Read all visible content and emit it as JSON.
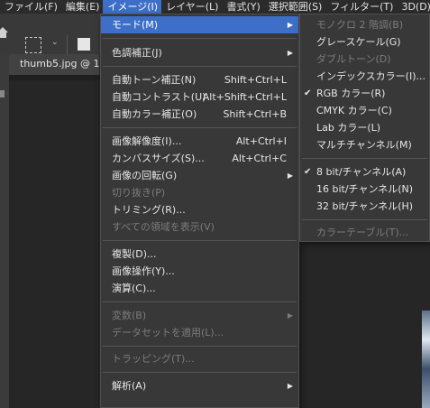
{
  "menubar": {
    "items": [
      "ファイル(F)",
      "編集(E)",
      "イメージ(I)",
      "レイヤー(L)",
      "書式(Y)",
      "選択範囲(S)",
      "フィルター(T)",
      "3D(D)",
      "表"
    ]
  },
  "document": {
    "tab_title": "thumb5.jpg @ 1"
  },
  "image_menu": {
    "mode": "モード(M)",
    "adjustments": "色調補正(J)",
    "auto_tone": {
      "label": "自動トーン補正(N)",
      "shortcut": "Shift+Ctrl+L"
    },
    "auto_contrast": {
      "label": "自動コントラスト(U)",
      "shortcut": "Alt+Shift+Ctrl+L"
    },
    "auto_color": {
      "label": "自動カラー補正(O)",
      "shortcut": "Shift+Ctrl+B"
    },
    "image_size": {
      "label": "画像解像度(I)...",
      "shortcut": "Alt+Ctrl+I"
    },
    "canvas_size": {
      "label": "カンバスサイズ(S)...",
      "shortcut": "Alt+Ctrl+C"
    },
    "rotation": "画像の回転(G)",
    "crop": "切り抜き(P)",
    "trim": "トリミング(R)...",
    "reveal_all": "すべての領域を表示(V)",
    "duplicate": "複製(D)...",
    "apply_image": "画像操作(Y)...",
    "calculations": "演算(C)...",
    "variables": "変数(B)",
    "apply_dataset": "データセットを適用(L)...",
    "trap": "トラッピング(T)...",
    "analysis": "解析(A)"
  },
  "mode_menu": {
    "bitmap": "モノクロ 2 階調(B)",
    "grayscale": "グレースケール(G)",
    "duotone": "ダブルトーン(D)",
    "indexed": "インデックスカラー(I)...",
    "rgb": "RGB カラー(R)",
    "cmyk": "CMYK カラー(C)",
    "lab": "Lab カラー(L)",
    "multichannel": "マルチチャンネル(M)",
    "bit8": "8 bit/チャンネル(A)",
    "bit16": "16 bit/チャンネル(N)",
    "bit32": "32 bit/チャンネル(H)",
    "color_table": "カラーテーブル(T)...",
    "check_mark": "✔"
  }
}
